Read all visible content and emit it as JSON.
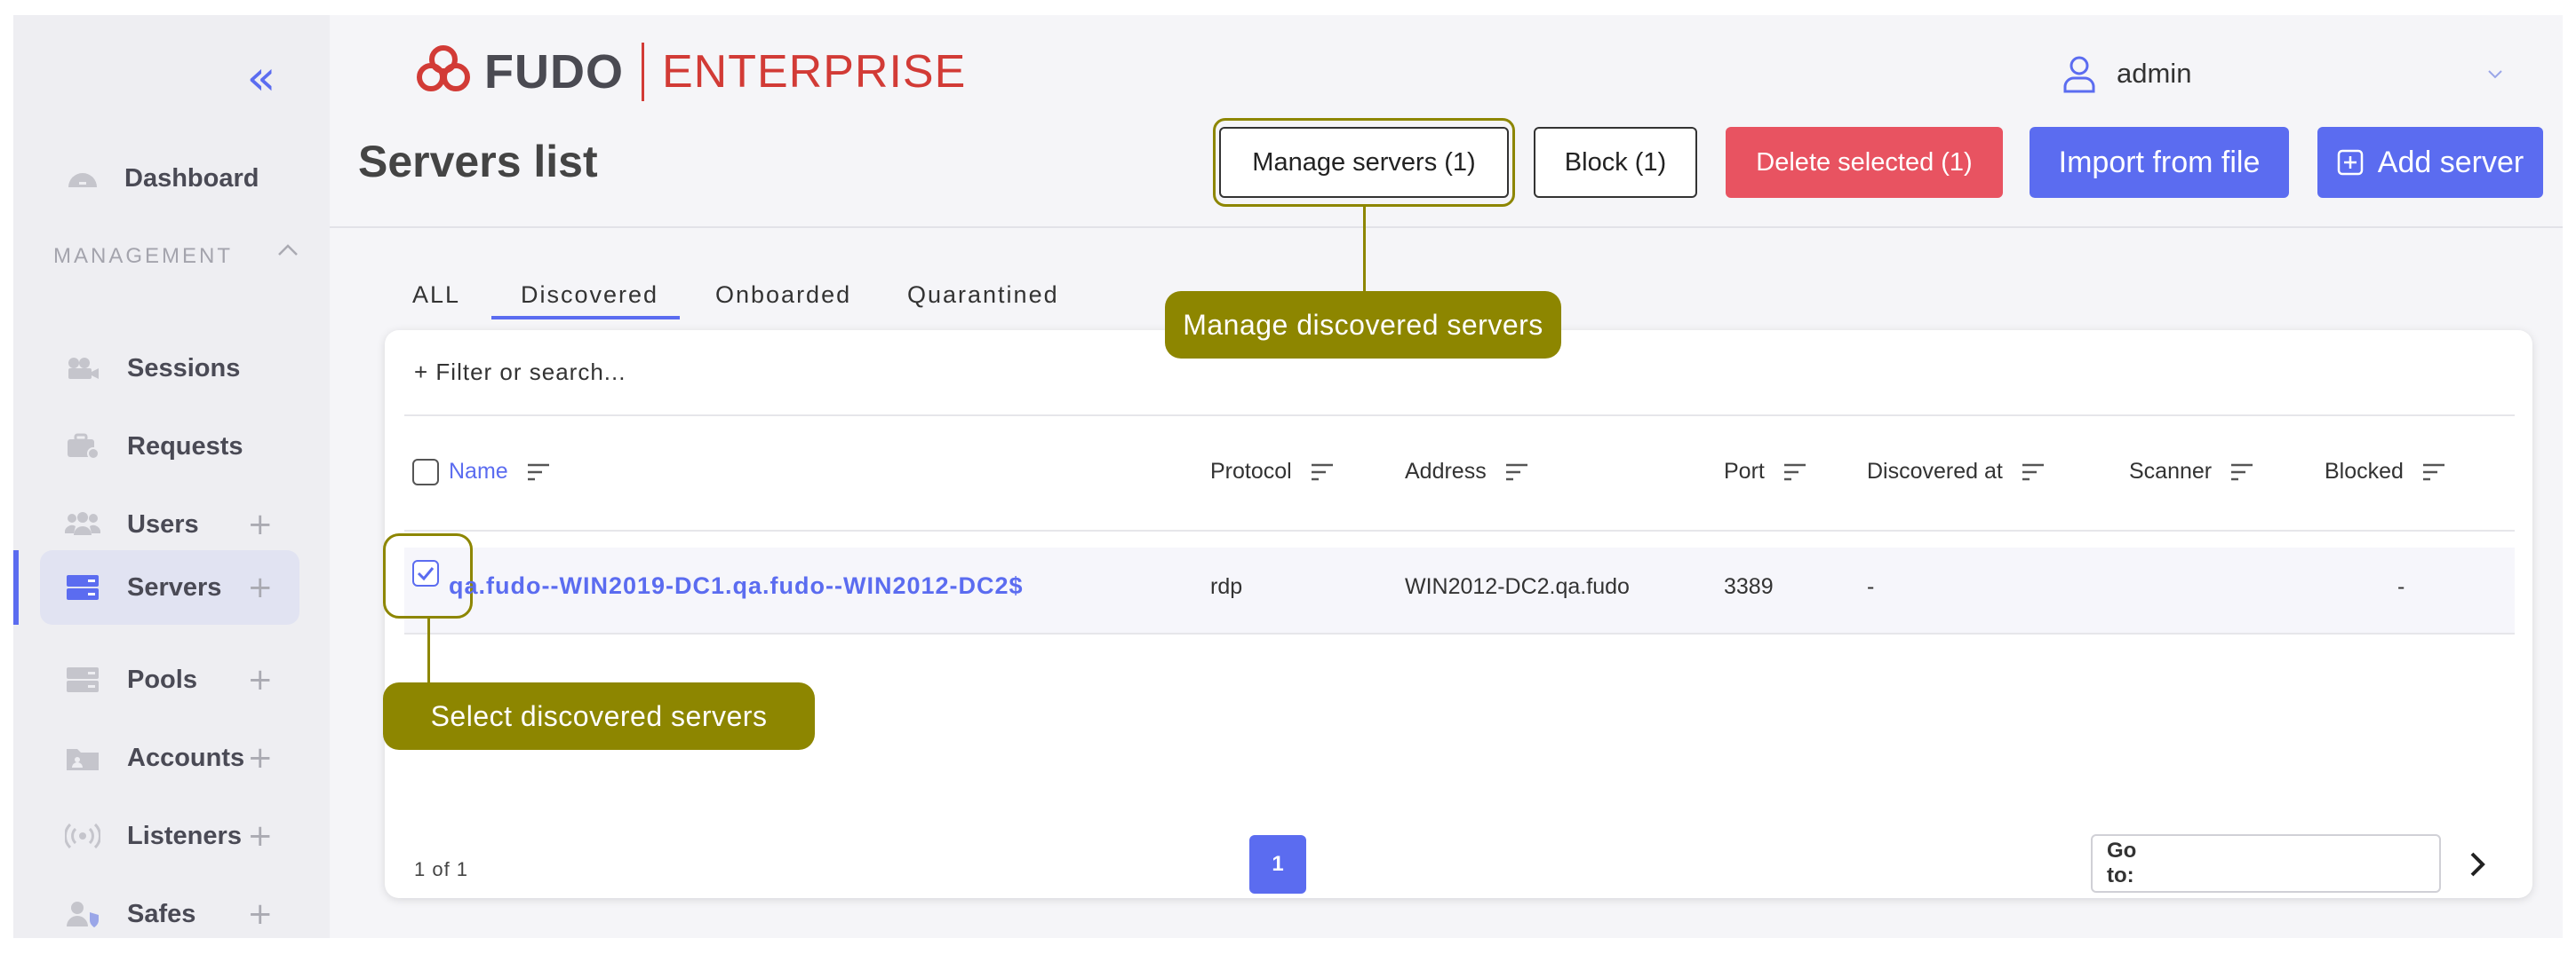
{
  "sidebar": {
    "collapse_glyph": "«",
    "dashboard_label": "Dashboard",
    "section_title": "MANAGEMENT",
    "items": [
      {
        "label": "Sessions",
        "icon": "camera-icon",
        "plus": ""
      },
      {
        "label": "Requests",
        "icon": "briefcase-icon",
        "plus": ""
      },
      {
        "label": "Users",
        "icon": "users-icon",
        "plus": "+"
      },
      {
        "label": "Servers",
        "icon": "server-icon",
        "plus": "+"
      },
      {
        "label": "Pools",
        "icon": "pool-icon",
        "plus": "+"
      },
      {
        "label": "Accounts",
        "icon": "folder-user-icon",
        "plus": "+"
      },
      {
        "label": "Listeners",
        "icon": "broadcast-icon",
        "plus": "+"
      },
      {
        "label": "Safes",
        "icon": "user-shield-icon",
        "plus": "+"
      }
    ],
    "active_item": "Servers"
  },
  "header": {
    "logo_word": "FUDO",
    "logo_edition": "ENTERPRISE",
    "user_name": "admin"
  },
  "page": {
    "title": "Servers list",
    "buttons": {
      "manage": "Manage servers (1)",
      "block": "Block (1)",
      "delete": "Delete selected (1)",
      "import": "Import from file",
      "add": "Add server"
    }
  },
  "tabs": [
    "ALL",
    "Discovered",
    "Onboarded",
    "Quarantined"
  ],
  "active_tab": "Discovered",
  "filter_label": "+ Filter or search...",
  "table": {
    "columns": [
      "Name",
      "Protocol",
      "Address",
      "Port",
      "Discovered at",
      "Scanner",
      "Blocked"
    ],
    "rows": [
      {
        "name": "qa.fudo--WIN2019-DC1.qa.fudo--WIN2012-DC2$",
        "protocol": "rdp",
        "address": "WIN2012-DC2.qa.fudo",
        "port": "3389",
        "discovered_at": "-",
        "scanner": "",
        "blocked": "-",
        "selected": true
      }
    ]
  },
  "pagination": {
    "summary": "1 of 1",
    "current_page": "1",
    "goto_label": "Go to:",
    "goto_value": ""
  },
  "callouts": {
    "manage": "Manage discovered servers",
    "select": "Select discovered servers"
  },
  "colors": {
    "accent": "#5b6cf0",
    "danger": "#e85361",
    "brand": "#d23b36",
    "callout": "#8d8600"
  }
}
